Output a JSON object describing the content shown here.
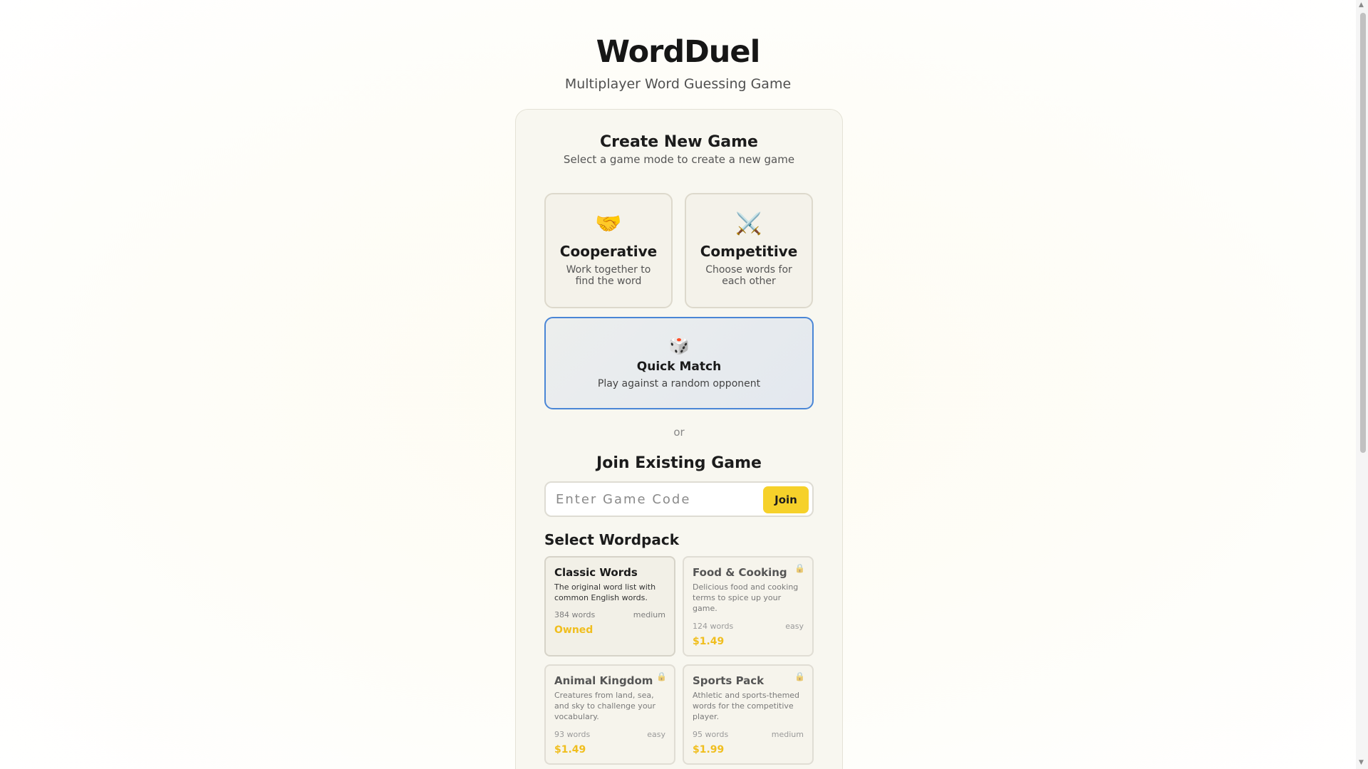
{
  "app": {
    "title": "WordDuel",
    "subtitle": "Multiplayer Word Guessing Game"
  },
  "create_game": {
    "title": "Create New Game",
    "subtitle": "Select a game mode to create a new game",
    "modes": [
      {
        "icon": "🤝",
        "icon_name": "handshake-icon",
        "name": "Cooperative",
        "description": "Work together to find the word"
      },
      {
        "icon": "⚔️",
        "icon_name": "crossed-swords-icon",
        "name": "Competitive",
        "description": "Choose words for each other"
      }
    ],
    "quick_match": {
      "icon": "🎲",
      "icon_name": "dice-icon",
      "name": "Quick Match",
      "description": "Play against a random opponent",
      "selected": true
    }
  },
  "divider": {
    "or_label": "or"
  },
  "join_game": {
    "title": "Join Existing Game",
    "placeholder": "Enter Game Code",
    "value": "",
    "button_label": "Join"
  },
  "wordpacks": {
    "heading": "Select Wordpack",
    "items": [
      {
        "name": "Classic Words",
        "description": "The original word list with common English words.",
        "words": "384 words",
        "difficulty": "medium",
        "price": "Owned",
        "locked": false
      },
      {
        "name": "Food & Cooking",
        "description": "Delicious food and cooking terms to spice up your game.",
        "words": "124 words",
        "difficulty": "easy",
        "price": "$1.49",
        "locked": true
      },
      {
        "name": "Animal Kingdom",
        "description": "Creatures from land, sea, and sky to challenge your vocabulary.",
        "words": "93 words",
        "difficulty": "easy",
        "price": "$1.49",
        "locked": true
      },
      {
        "name": "Sports Pack",
        "description": "Athletic and sports-themed words for the competitive player.",
        "words": "95 words",
        "difficulty": "medium",
        "price": "$1.99",
        "locked": true
      }
    ]
  },
  "colors": {
    "accent_yellow": "#f6d12a",
    "price_gold": "#f0be1e",
    "selected_border": "#4a86d6"
  },
  "icons": {
    "lock": "🔒",
    "scroll_up": "▲",
    "scroll_down": "▼"
  }
}
